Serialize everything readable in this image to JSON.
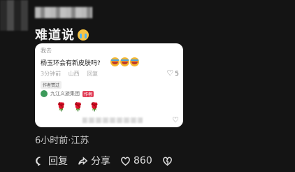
{
  "comment": {
    "text": "难道说"
  },
  "quoted": {
    "user": "我去",
    "question": "杨玉环会有新皮肤吗?",
    "time": "3分钟前",
    "location": "山西",
    "reply_label": "回复",
    "likes": "5",
    "author_tag": "作者赞过",
    "org_name": "九江义旅集团",
    "author_badge": "作者"
  },
  "meta": {
    "time_location": "6小时前·江苏"
  },
  "actions": {
    "reply": "回复",
    "share": "分享",
    "likes": "860"
  }
}
